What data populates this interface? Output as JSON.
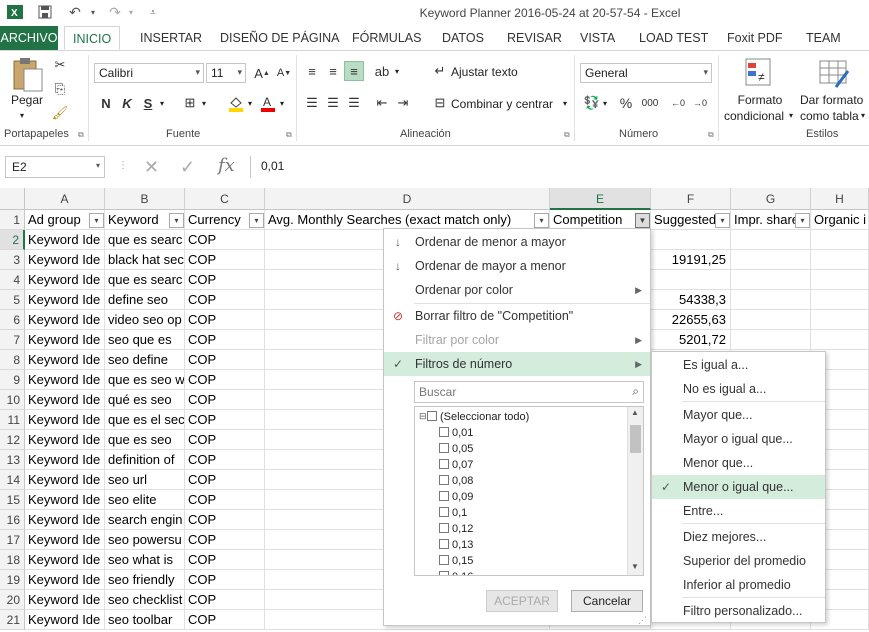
{
  "window": {
    "title": "Keyword Planner 2016-05-24 at 20-57-54 - Excel"
  },
  "tabs": [
    "ARCHIVO",
    "INICIO",
    "INSERTAR",
    "DISEÑO DE PÁGINA",
    "FÓRMULAS",
    "DATOS",
    "REVISAR",
    "VISTA",
    "LOAD TEST",
    "Foxit PDF",
    "TEAM"
  ],
  "ribbon": {
    "paste_label": "Pegar",
    "font_name": "Calibri",
    "font_size": "11",
    "bold": "N",
    "italic": "K",
    "underline": "S",
    "wrap_text": "Ajustar texto",
    "merge_center": "Combinar y centrar",
    "number_format": "General",
    "percent": "%",
    "thousands": "000",
    "cond_format_1": "Formato",
    "cond_format_2": "condicional",
    "format_table_1": "Dar formato",
    "format_table_2": "como tabla",
    "groups": {
      "clipboard": "Portapapeles",
      "font": "Fuente",
      "alignment": "Alineación",
      "number": "Número",
      "styles": "Estilos"
    }
  },
  "formula_bar": {
    "name_box": "E2",
    "fx": "fx",
    "value": "0,01"
  },
  "columns": [
    "A",
    "B",
    "C",
    "D",
    "E",
    "F",
    "G",
    "H"
  ],
  "headers": [
    "Ad group",
    "Keyword",
    "Currency",
    "Avg. Monthly Searches (exact match only)",
    "Competition",
    "Suggested",
    "Impr. share",
    "Organic i"
  ],
  "rows": [
    {
      "n": "2",
      "a": "Keyword Ide",
      "b": "que es searc",
      "c": "COP",
      "f": ""
    },
    {
      "n": "3",
      "a": "Keyword Ide",
      "b": "black hat sec",
      "c": "COP",
      "f": "19191,25"
    },
    {
      "n": "4",
      "a": "Keyword Ide",
      "b": "que es searc",
      "c": "COP",
      "f": ""
    },
    {
      "n": "5",
      "a": "Keyword Ide",
      "b": "define seo",
      "c": "COP",
      "f": "54338,3"
    },
    {
      "n": "6",
      "a": "Keyword Ide",
      "b": "video seo op",
      "c": "COP",
      "f": "22655,63"
    },
    {
      "n": "7",
      "a": "Keyword Ide",
      "b": "seo que es",
      "c": "COP",
      "f": "5201,72"
    },
    {
      "n": "8",
      "a": "Keyword Ide",
      "b": "seo define",
      "c": "COP",
      "f": ""
    },
    {
      "n": "9",
      "a": "Keyword Ide",
      "b": "que es seo w",
      "c": "COP",
      "f": ""
    },
    {
      "n": "10",
      "a": "Keyword Ide",
      "b": "qué es seo",
      "c": "COP",
      "f": ""
    },
    {
      "n": "11",
      "a": "Keyword Ide",
      "b": "que es el sec",
      "c": "COP",
      "f": ""
    },
    {
      "n": "12",
      "a": "Keyword Ide",
      "b": "que es seo",
      "c": "COP",
      "f": ""
    },
    {
      "n": "13",
      "a": "Keyword Ide",
      "b": "definition of",
      "c": "COP",
      "f": ""
    },
    {
      "n": "14",
      "a": "Keyword Ide",
      "b": "seo url",
      "c": "COP",
      "f": ""
    },
    {
      "n": "15",
      "a": "Keyword Ide",
      "b": "seo elite",
      "c": "COP",
      "f": ""
    },
    {
      "n": "16",
      "a": "Keyword Ide",
      "b": "search engin",
      "c": "COP",
      "f": ""
    },
    {
      "n": "17",
      "a": "Keyword Ide",
      "b": "seo powersu",
      "c": "COP",
      "f": ""
    },
    {
      "n": "18",
      "a": "Keyword Ide",
      "b": "seo what is",
      "c": "COP",
      "f": ""
    },
    {
      "n": "19",
      "a": "Keyword Ide",
      "b": "seo friendly",
      "c": "COP",
      "f": ""
    },
    {
      "n": "20",
      "a": "Keyword Ide",
      "b": "seo checklist",
      "c": "COP",
      "f": ""
    },
    {
      "n": "21",
      "a": "Keyword Ide",
      "b": "seo toolbar",
      "c": "COP",
      "f": ""
    }
  ],
  "filter_menu": {
    "sort_asc": "Ordenar de menor a mayor",
    "sort_desc": "Ordenar de mayor a menor",
    "sort_color": "Ordenar por color",
    "clear_filter": "Borrar filtro de \"Competition\"",
    "filter_color": "Filtrar por color",
    "number_filters": "Filtros de número",
    "search_placeholder": "Buscar",
    "list": [
      "(Seleccionar todo)",
      "0,01",
      "0,05",
      "0,07",
      "0,08",
      "0,09",
      "0,1",
      "0,12",
      "0,13",
      "0,15",
      "0,16"
    ],
    "ok": "ACEPTAR",
    "cancel": "Cancelar"
  },
  "number_submenu": [
    "Es igual a...",
    "No es igual a...",
    "Mayor que...",
    "Mayor o igual que...",
    "Menor que...",
    "Menor o igual que...",
    "Entre...",
    "Diez mejores...",
    "Superior del promedio",
    "Inferior al promedio",
    "Filtro personalizado..."
  ],
  "colors": {
    "accent": "#217346",
    "highlight": "#d3ecdc"
  }
}
